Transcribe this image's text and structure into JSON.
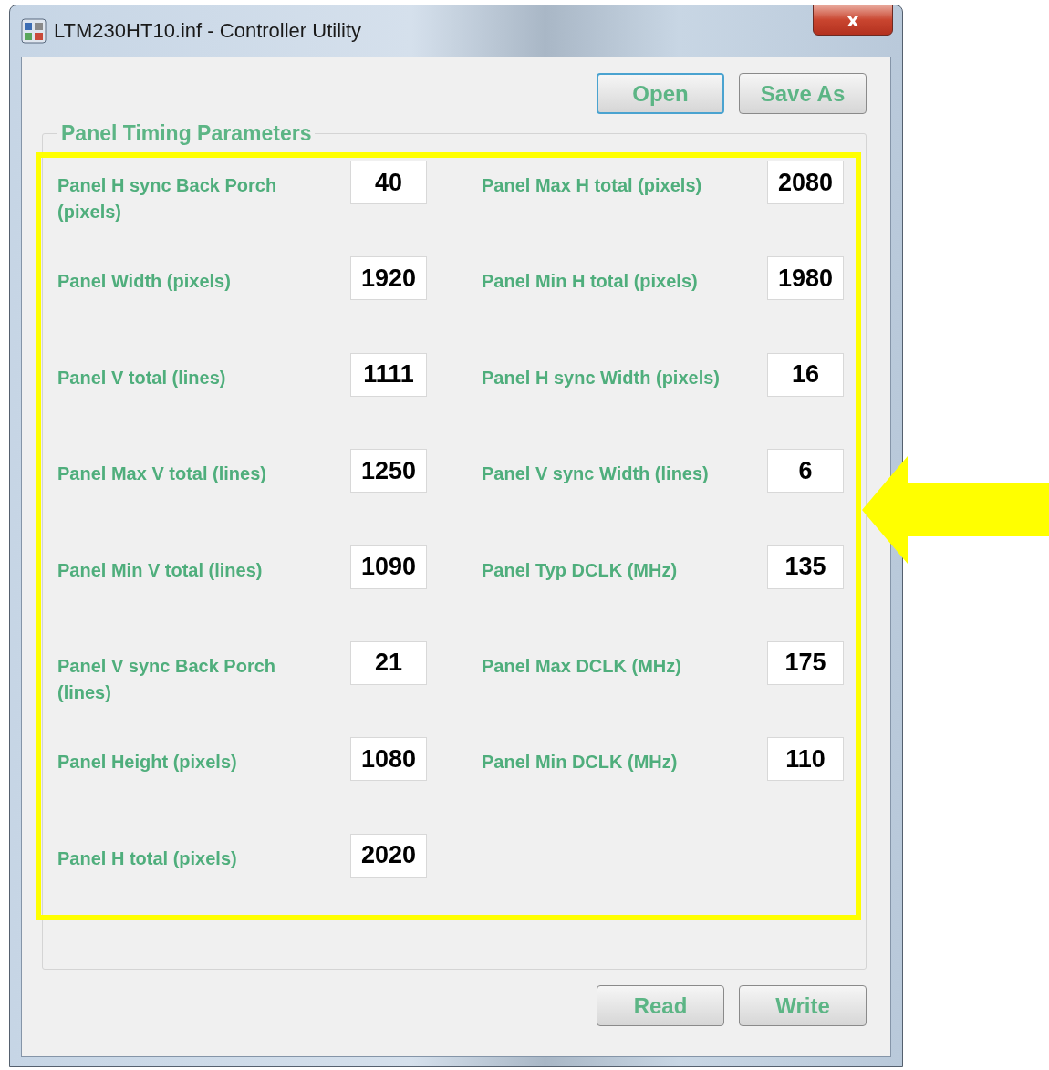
{
  "window": {
    "title": "LTM230HT10.inf - Controller Utility",
    "close_label": "x"
  },
  "top_buttons": [
    {
      "label": "Open",
      "focused": true
    },
    {
      "label": "Save As",
      "focused": false
    }
  ],
  "group": {
    "title": "Panel Timing Parameters",
    "left_fields": [
      {
        "label": "Panel H sync Back Porch (pixels)",
        "value": "40"
      },
      {
        "label": "Panel Width (pixels)",
        "value": "1920"
      },
      {
        "label": "Panel V total (lines)",
        "value": "1111"
      },
      {
        "label": "Panel Max V total (lines)",
        "value": "1250"
      },
      {
        "label": "Panel Min V total (lines)",
        "value": "1090"
      },
      {
        "label": "Panel V sync Back Porch (lines)",
        "value": "21"
      },
      {
        "label": "Panel Height (pixels)",
        "value": "1080"
      },
      {
        "label": "Panel H total (pixels)",
        "value": "2020"
      }
    ],
    "right_fields": [
      {
        "label": "Panel Max H total (pixels)",
        "value": "2080"
      },
      {
        "label": "Panel Min H total (pixels)",
        "value": "1980"
      },
      {
        "label": "Panel H sync Width (pixels)",
        "value": "16"
      },
      {
        "label": "Panel V sync Width (lines)",
        "value": "6"
      },
      {
        "label": "Panel Typ DCLK (MHz)",
        "value": "135"
      },
      {
        "label": "Panel Max DCLK (MHz)",
        "value": "175"
      },
      {
        "label": "Panel Min DCLK (MHz)",
        "value": "110"
      }
    ]
  },
  "bottom_buttons": [
    {
      "label": "Read",
      "focused": false
    },
    {
      "label": "Write",
      "focused": false
    }
  ]
}
